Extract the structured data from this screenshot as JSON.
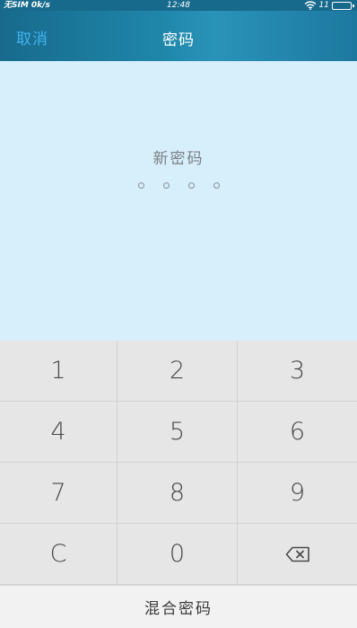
{
  "status_bar": {
    "carrier": "无SIM 0k/s",
    "time": "12:48",
    "battery": "11"
  },
  "nav": {
    "cancel_label": "取消",
    "title": "密码"
  },
  "content": {
    "prompt": "新密码",
    "pin_length": 4
  },
  "keypad": {
    "keys": [
      "1",
      "2",
      "3",
      "4",
      "5",
      "6",
      "7",
      "8",
      "9",
      "C",
      "0"
    ],
    "backspace_icon": "backspace-icon"
  },
  "footer": {
    "mixed_password_label": "混合密码"
  },
  "colors": {
    "nav_background": "#176a8c",
    "cancel_accent": "#43b3ee",
    "content_background": "#d6effb",
    "keypad_background": "#e6e6e6"
  }
}
